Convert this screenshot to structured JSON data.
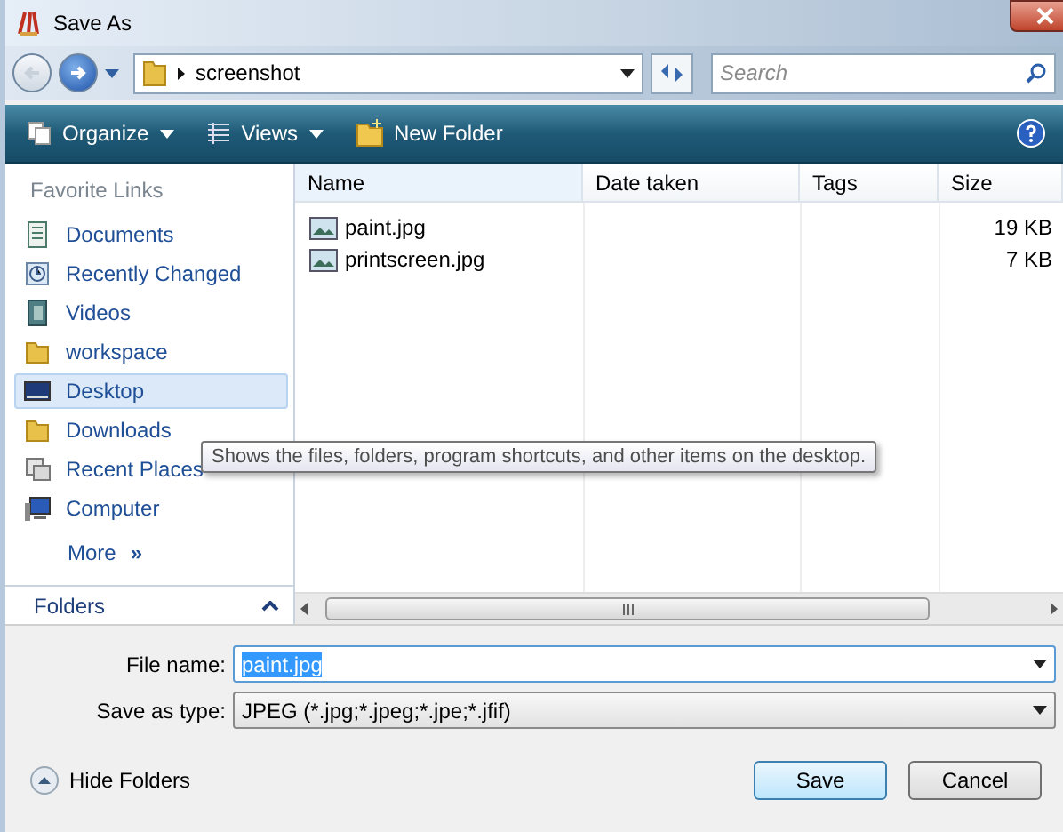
{
  "window": {
    "title": "Save As"
  },
  "address": {
    "path": "screenshot",
    "search_placeholder": "Search"
  },
  "toolbar": {
    "items": [
      {
        "kind": "menu",
        "label": "Organize"
      },
      {
        "kind": "menu",
        "label": "Views"
      },
      {
        "kind": "button",
        "label": "New Folder"
      }
    ]
  },
  "sidebar": {
    "heading": "Favorite Links",
    "items": [
      {
        "label": "Documents",
        "selected": false
      },
      {
        "label": "Recently Changed",
        "selected": false
      },
      {
        "label": "Videos",
        "selected": false
      },
      {
        "label": "workspace",
        "selected": false
      },
      {
        "label": "Desktop",
        "selected": true
      },
      {
        "label": "Downloads",
        "selected": false
      },
      {
        "label": "Recent Places",
        "selected": false
      },
      {
        "label": "Computer",
        "selected": false
      }
    ],
    "more": "More",
    "more_glyph": "»",
    "folders": "Folders"
  },
  "table": {
    "columns": [
      "Name",
      "Date taken",
      "Tags",
      "Size"
    ],
    "rows": [
      {
        "name": "paint.jpg",
        "size": "19 KB"
      },
      {
        "name": "printscreen.jpg",
        "size": "7 KB"
      }
    ]
  },
  "tooltip": "Shows the files, folders, program shortcuts, and other items on the desktop.",
  "form": {
    "file_name_label": "File name:",
    "file_name": "paint.jpg",
    "type_label": "Save as type:",
    "type": "JPEG (*.jpg;*.jpeg;*.jpe;*.jfif)"
  },
  "footer": {
    "hide_folders": "Hide Folders",
    "buttons": [
      {
        "label": "Save",
        "kind": "primary"
      },
      {
        "label": "Cancel",
        "kind": "secondary"
      }
    ]
  }
}
